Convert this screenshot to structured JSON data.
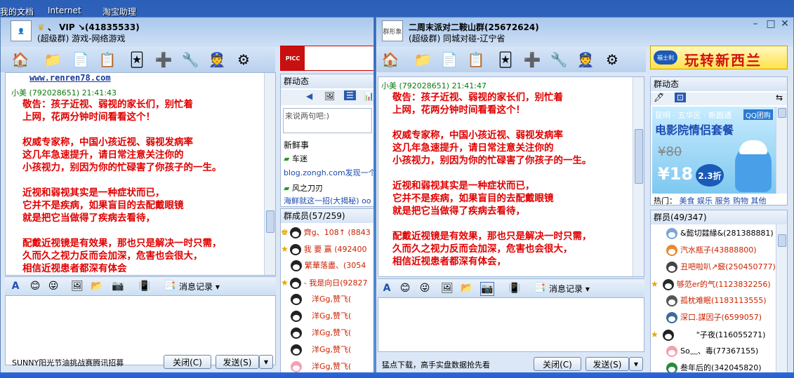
{
  "desktop": {
    "labels": [
      "我的文档",
      "Internet",
      "淘宝助理"
    ]
  },
  "left": {
    "title_line1": "、 VIP  ↘(41835533)",
    "title_line2": "(超级群) 游戏-网络游戏",
    "url_line": "www.renren78.com",
    "msg_header": "小美 (792028651)  21:41:43",
    "messages": [
      "敬告：孩子近视、弱视的家长们，别忙着",
      "上网，花两分钟时间看看这个！",
      "",
      "权威专家称，中国小孩近视、弱视发病率",
      "这几年急速提升，请日常注意关注你的",
      "小孩视力，别因为你的忙碌害了你孩子的一生。",
      "",
      "近视和弱视其实是一种症状而已，",
      "它并不是疾病，如果盲目的去配戴眼镜",
      "就是把它当做得了疾病去看待，",
      "",
      "配戴近视镜是有效果，那也只是解决一时只需，",
      "久而久之视力反而会加深，危害也会很大，",
      "相信近视患者都深有体会"
    ],
    "history_label": "消息记录",
    "bottom_notice": "SUNNY阳光节油挑战赛腾讯招募",
    "close_label": "关闭(C)",
    "send_label": "发送(S)",
    "dynamic_title": "群动态",
    "dynamic_placeholder": "来说两句吧:)",
    "news_title": "新鲜事",
    "news": [
      {
        "name": "车迷",
        "text": "blog.zongh.com发现一个"
      },
      {
        "name": "风之刀刃",
        "text": "海鲜就这一招(大揭秘) oo"
      }
    ],
    "members_title": "群成员(57/259)",
    "members": [
      {
        "text": "齊g、108↑ (8843"
      },
      {
        "text": "我 要 赢 (492400"
      },
      {
        "text": "繁華落盡、(3054"
      },
      {
        "text": "- 我是向日(92827"
      },
      {
        "text": "洋Gg,赞飞("
      },
      {
        "text": "洋Gg,赞飞("
      },
      {
        "text": "洋Gg,赞飞("
      },
      {
        "text": "洋Gg,赞飞("
      },
      {
        "text": "洋Gg,赞飞("
      }
    ]
  },
  "right": {
    "title_line1": "二周末派对二鞍山群(25672624)",
    "title_line2": "(超级群) 同城对碰-辽宁省",
    "avatar_text": "群形象",
    "msg_header": "小美 (792028651)  21:41:47",
    "messages": [
      "敬告：孩子近视、弱视的家长们，别忙着",
      "上网，花两分钟时间看看这个！",
      "",
      "权威专家称，中国小孩近视、弱视发病率",
      "这几年急速提升，请日常注意关注你的",
      "小孩视力，别因为你的忙碌害了你孩子的一生。",
      "",
      "近视和弱视其实是一种症状而已，",
      "它并不是疾病，如果盲目的去配戴眼镜",
      "就是把它当做得了疾病去看待，",
      "",
      "配戴近视镜是有效果，那也只是解决一时只需，",
      "久而久之视力反而会加深，危害也会很大，",
      "相信近视患者都深有体会，"
    ],
    "history_label": "消息记录",
    "bottom_notice": "猛点下载，高手实盘数据抢先看",
    "close_label": "关闭(C)",
    "send_label": "发送(S)",
    "ad_banner": "玩转新西兰",
    "ad_logo": "福士利",
    "dynamic_title": "群动态",
    "ad_city": "昆明 · 五华区 · 新圆通",
    "ad_tag": "QQ团购",
    "ad_title": "电影院情侣套餐",
    "ad_old_price": "¥80",
    "ad_new_price": "¥18",
    "ad_discount": "2.3折",
    "hot_label": "热门：",
    "hot_items": [
      "美食",
      "娱乐",
      "服务",
      "购物",
      "其他"
    ],
    "members_title": "群员(49/347)",
    "members": [
      {
        "text": "&懿切㵘緣&(281388881)"
      },
      {
        "text": "汽水瓶子(43888800)"
      },
      {
        "text": "丑吧啦叭↗竅(250450777)"
      },
      {
        "text": "够范er的气(1123832256)"
      },
      {
        "text": "孤枕难眠(1183113555)"
      },
      {
        "text": "深口.謀因子(6599057)"
      },
      {
        "text": "\"子夜(116055271)"
      },
      {
        "text": "So﹏、毒(77367155)"
      },
      {
        "text": "叁年后的(342045820)"
      }
    ]
  },
  "colors": {
    "message_red": "#e00000",
    "name_green": "#0a7a0a",
    "member_red": "#cc2200"
  }
}
